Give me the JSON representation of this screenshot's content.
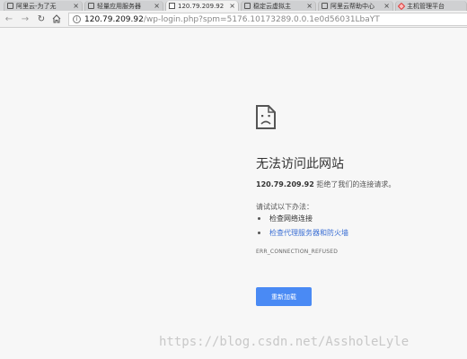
{
  "tabs": [
    {
      "label": "阿里云-为了无"
    },
    {
      "label": "轻量应用服务器"
    },
    {
      "label": "120.79.209.92"
    },
    {
      "label": "稳定云虚拟主"
    },
    {
      "label": "阿里云帮助中心"
    },
    {
      "label": "主机管理平台"
    }
  ],
  "address": {
    "host": "120.79.209.92",
    "path": "/wp-login.php?spm=5176.10173289.0.0.1e0d56031LbaYT"
  },
  "error": {
    "title": "无法访问此网站",
    "host": "120.79.209.92",
    "message": " 拒绝了我们的连接请求。",
    "try_label": "请试试以下办法：",
    "suggestion_1": "检查网络连接",
    "suggestion_2": "检查代理服务器和防火墙",
    "code": "ERR_CONNECTION_REFUSED",
    "reload_label": "重新加载"
  },
  "watermark": "https://blog.csdn.net/AssholeLyle"
}
